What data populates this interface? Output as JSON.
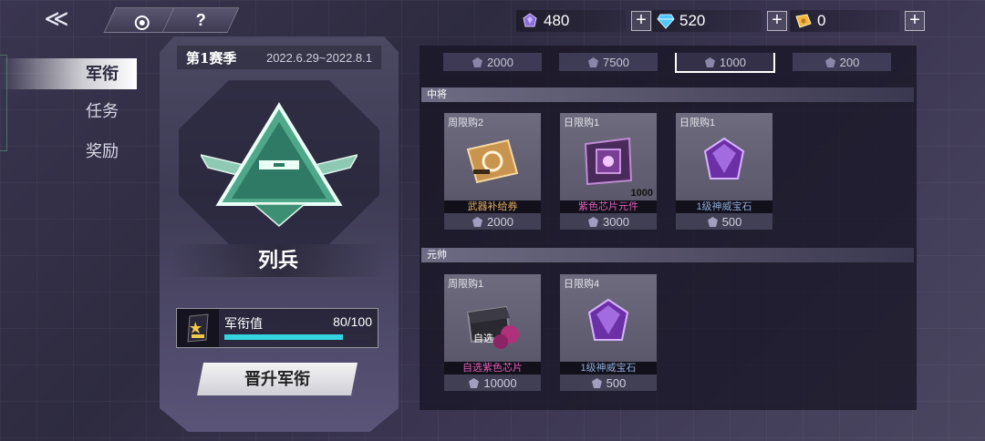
{
  "topbar": {
    "back_glyph": "≪",
    "help_glyph": "?",
    "currencies": [
      {
        "icon": "purple-crystal-icon",
        "value": "480",
        "color": "#8b6fd6"
      },
      {
        "icon": "blue-diamond-icon",
        "value": "520",
        "color": "#4fc6ff"
      },
      {
        "icon": "gold-ticket-icon",
        "value": "0",
        "color": "#f2b740"
      }
    ],
    "plus_glyph": "+"
  },
  "nav": {
    "items": [
      {
        "label": "军衔",
        "active": true
      },
      {
        "label": "任务",
        "active": false
      },
      {
        "label": "奖励",
        "active": false
      }
    ]
  },
  "rank": {
    "season_title": "第1赛季",
    "season_date": "2022.6.29~2022.8.1",
    "rank_name": "列兵",
    "points_label": "军衔值",
    "points_value": "80/100",
    "progress": 0.8,
    "promote_label": "晋升军衔",
    "accent": "#32d5e0",
    "emblem_color": "#4fa88a"
  },
  "shop": {
    "top_prices": [
      "2000",
      "7500",
      "1000",
      "200"
    ],
    "sections": [
      {
        "title": "中将",
        "items": [
          {
            "limit": "周限购2",
            "name": "武器补给券",
            "price": "2000",
            "qty": "",
            "name_color": "#e0a860",
            "art": "ticket"
          },
          {
            "limit": "日限购1",
            "name": "紫色芯片元件",
            "price": "3000",
            "qty": "1000",
            "name_color": "#e05fb6",
            "art": "chip"
          },
          {
            "limit": "日限购1",
            "name": "1级神威宝石",
            "price": "500",
            "qty": "",
            "name_color": "#8fa9d6",
            "art": "gem"
          }
        ]
      },
      {
        "title": "元帅",
        "items": [
          {
            "limit": "周限购1",
            "name": "自选紫色芯片",
            "price": "10000",
            "qty": "",
            "name_color": "#e05fb6",
            "art": "box"
          },
          {
            "limit": "日限购4",
            "name": "1级神威宝石",
            "price": "500",
            "qty": "",
            "name_color": "#8fa9d6",
            "art": "gem"
          }
        ]
      }
    ],
    "box_label": "自选"
  }
}
